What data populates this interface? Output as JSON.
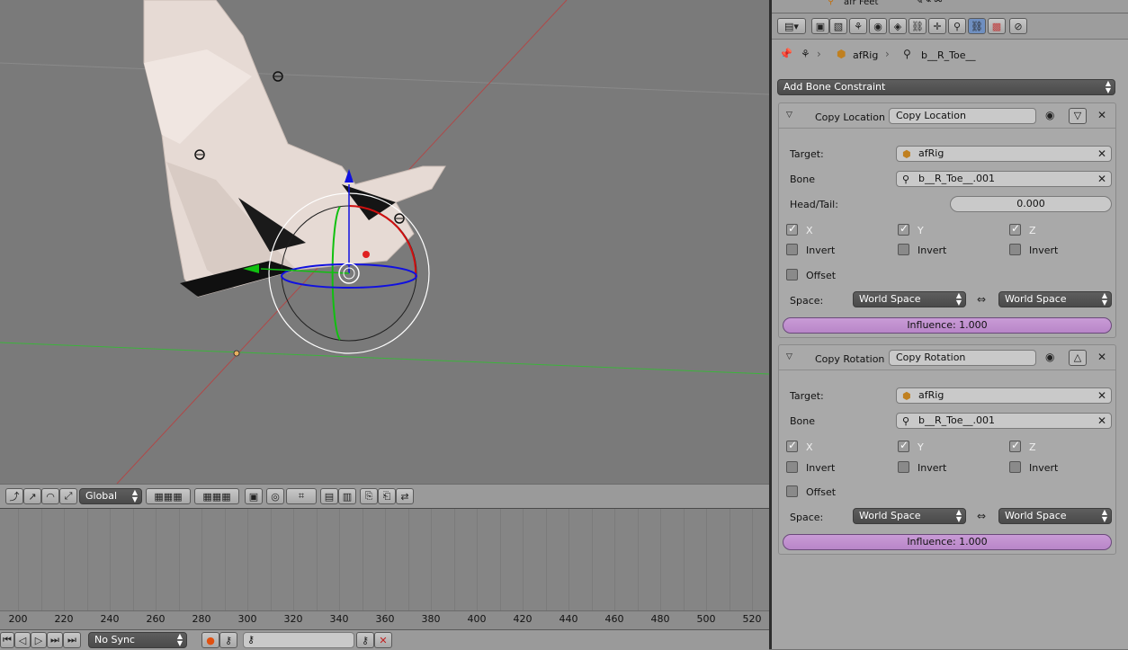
{
  "viewport": {
    "orientation_mode": "Global",
    "colors": {
      "x_axis": "#d01010",
      "y_axis": "#10c010",
      "z_axis": "#1010e0",
      "mesh": "#e8dcd6"
    }
  },
  "timeline": {
    "frames": [
      "200",
      "220",
      "240",
      "260",
      "280",
      "300",
      "320",
      "340",
      "360",
      "380",
      "400",
      "420",
      "440",
      "460",
      "480",
      "500",
      "520"
    ],
    "sync_mode": "No Sync"
  },
  "props": {
    "tabs": [
      "render-icon",
      "render-layers-icon",
      "scene-icon",
      "world-icon",
      "object-icon",
      "constraint-icon",
      "data-icon",
      "bone-icon",
      "bone-constraint-icon",
      "texture-icon",
      "physics-icon"
    ],
    "outliner_item": "afr Feet",
    "breadcrumb": {
      "object": "afRig",
      "bone": "b__R_Toe__"
    },
    "add_constraint": "Add Bone Constraint",
    "constraints": [
      {
        "title": "Copy Location",
        "name_value": "Copy Location",
        "target_label": "Target:",
        "target": "afRig",
        "bone_label": "Bone",
        "bone": "b__R_Toe__.001",
        "head_tail_label": "Head/Tail:",
        "head_tail": "0.000",
        "axes": [
          {
            "axis": "X",
            "on": true,
            "invert_label": "Invert",
            "invert": false
          },
          {
            "axis": "Y",
            "on": true,
            "invert_label": "Invert",
            "invert": false
          },
          {
            "axis": "Z",
            "on": true,
            "invert_label": "Invert",
            "invert": false
          }
        ],
        "offset_label": "Offset",
        "space_label": "Space:",
        "owner_space": "World Space",
        "target_space": "World Space",
        "influence": "Influence: 1.000"
      },
      {
        "title": "Copy Rotation",
        "name_value": "Copy Rotation",
        "target_label": "Target:",
        "target": "afRig",
        "bone_label": "Bone",
        "bone": "b__R_Toe__.001",
        "axes": [
          {
            "axis": "X",
            "on": true,
            "invert_label": "Invert",
            "invert": false
          },
          {
            "axis": "Y",
            "on": true,
            "invert_label": "Invert",
            "invert": false
          },
          {
            "axis": "Z",
            "on": true,
            "invert_label": "Invert",
            "invert": false
          }
        ],
        "offset_label": "Offset",
        "space_label": "Space:",
        "owner_space": "World Space",
        "target_space": "World Space",
        "influence": "Influence: 1.000"
      }
    ],
    "influence_color": "#c299d2"
  }
}
